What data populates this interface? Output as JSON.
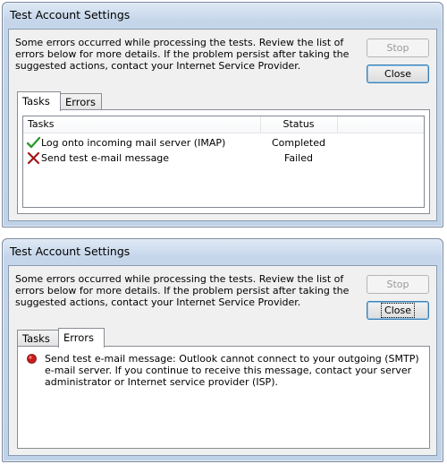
{
  "window1": {
    "title": "Test Account Settings",
    "message": "Some errors occurred while processing the tests. Review the list of errors below for more details. If the problem persist after taking the suggested actions, contact your Internet Service Provider.",
    "stop_label": "Stop",
    "close_label": "Close",
    "tabs": [
      "Tasks",
      "Errors"
    ],
    "active_tab": "Tasks",
    "columns": [
      "Tasks",
      "Status"
    ],
    "rows": [
      {
        "task": "Log onto incoming mail server (IMAP)",
        "status": "Completed",
        "icon": "check-icon"
      },
      {
        "task": "Send test e-mail message",
        "status": "Failed",
        "icon": "x-icon"
      }
    ]
  },
  "window2": {
    "title": "Test Account Settings",
    "message": "Some errors occurred while processing the tests. Review the list of errors below for more details. If the problem persist after taking the suggested actions, contact your Internet Service Provider.",
    "stop_label": "Stop",
    "close_label": "Close",
    "tabs": [
      "Tasks",
      "Errors"
    ],
    "active_tab": "Errors",
    "error_text": "Send test e-mail message: Outlook cannot connect to your outgoing (SMTP) e-mail server. If you continue to receive this message, contact your server administrator or Internet service provider (ISP).",
    "error_icon": "error-icon"
  },
  "colors": {
    "check": "#2e9a2e",
    "fail": "#a01818",
    "error_dot": "#c81e1e"
  }
}
